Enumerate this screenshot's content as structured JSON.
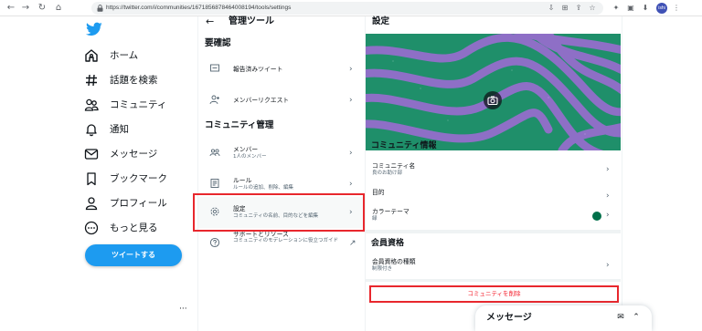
{
  "browser": {
    "url": "https://twitter.com/i/communities/1671856878464008194/tools/settings",
    "profile_initials": "ishi"
  },
  "sidebar": {
    "logo_icon": "twitter-bird-icon",
    "items": [
      {
        "label": "ホーム",
        "icon": "home-icon"
      },
      {
        "label": "話題を検索",
        "icon": "hashtag-icon"
      },
      {
        "label": "コミュニティ",
        "icon": "communities-icon"
      },
      {
        "label": "通知",
        "icon": "bell-icon"
      },
      {
        "label": "メッセージ",
        "icon": "envelope-icon"
      },
      {
        "label": "ブックマーク",
        "icon": "bookmark-icon"
      },
      {
        "label": "プロフィール",
        "icon": "person-icon"
      },
      {
        "label": "もっと見る",
        "icon": "more-circle-icon"
      }
    ],
    "tweet_button": "ツイートする",
    "account_more": "···"
  },
  "tools": {
    "back": "←",
    "title": "管理ツール",
    "section_review": "要確認",
    "review_items": [
      {
        "label": "報告済みツイート"
      },
      {
        "label": "メンバーリクエスト"
      }
    ],
    "section_manage": "コミュニティ管理",
    "manage_items": [
      {
        "label": "メンバー",
        "sub": "1人のメンバー"
      },
      {
        "label": "ルール",
        "sub": "ルールの追加、削除、編集"
      },
      {
        "label": "設定",
        "sub": "コミュニティの名前、目的などを編集"
      },
      {
        "label": "サポートとリソース",
        "sub": "コミュニティのモデレーションに役立つガイド"
      }
    ]
  },
  "settings": {
    "title": "設定",
    "info_heading": "コミュニティ情報",
    "name_label": "コミュニティ名",
    "name_value": "良のお助け部",
    "purpose_label": "目的",
    "color_label": "カラーテーマ",
    "color_value": "緑",
    "theme_color": "#00704a",
    "membership_heading": "会員資格",
    "membership_label": "会員資格の種類",
    "membership_value": "制限付き",
    "delete_button": "コミュニティを削除"
  },
  "messages_drawer": {
    "title": "メッセージ"
  },
  "colors": {
    "accent": "#1d9bf0",
    "danger": "#f4212e",
    "highlight": "#e8272d",
    "banner_green": "#1f8f6a",
    "banner_purple": "#8e6fc6"
  }
}
